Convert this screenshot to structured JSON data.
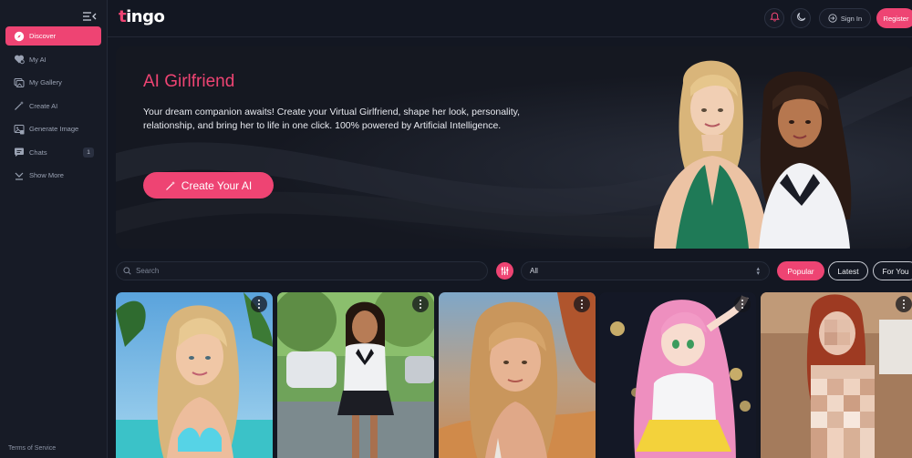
{
  "brand": {
    "logo_text": "tingo",
    "logo_accent": "t",
    "logo_rest": "ingo",
    "accent_color": "#ee4473"
  },
  "sidebar": {
    "items": [
      {
        "label": "Discover",
        "icon": "compass-icon",
        "active": true
      },
      {
        "label": "My AI",
        "icon": "heart-icon",
        "active": false
      },
      {
        "label": "My Gallery",
        "icon": "gallery-icon",
        "active": false
      },
      {
        "label": "Create AI",
        "icon": "magic-wand-icon",
        "active": false
      },
      {
        "label": "Generate Image",
        "icon": "image-generate-icon",
        "active": false
      },
      {
        "label": "Chats",
        "icon": "chat-icon",
        "active": false,
        "badge": "1"
      },
      {
        "label": "Show More",
        "icon": "chevron-down-icon",
        "active": false
      }
    ],
    "footer_link": "Terms of Service"
  },
  "header": {
    "sign_in_label": "Sign In",
    "register_label": "Register",
    "notification_icon": "bell-icon",
    "theme_icon": "moon-icon"
  },
  "hero": {
    "title": "AI Girlfriend",
    "description": "Your dream companion awaits! Create your Virtual Girlfriend, shape her look, personality, relationship, and bring her to life in one click. 100% powered by Artificial Intelligence.",
    "cta_label": "Create Your AI",
    "cta_icon": "magic-wand-icon"
  },
  "filters": {
    "search_placeholder": "Search",
    "category_value": "All",
    "sort_options": [
      "Popular",
      "Latest",
      "For You"
    ],
    "active_sort": "Popular"
  },
  "cards": [
    {
      "id": "card-1",
      "theme": "beach-blonde"
    },
    {
      "id": "card-2",
      "theme": "street-schoolgirl"
    },
    {
      "id": "card-3",
      "theme": "desert-blonde"
    },
    {
      "id": "card-4",
      "theme": "anime-pink-hair"
    },
    {
      "id": "card-5",
      "theme": "redhead-blurred"
    }
  ]
}
